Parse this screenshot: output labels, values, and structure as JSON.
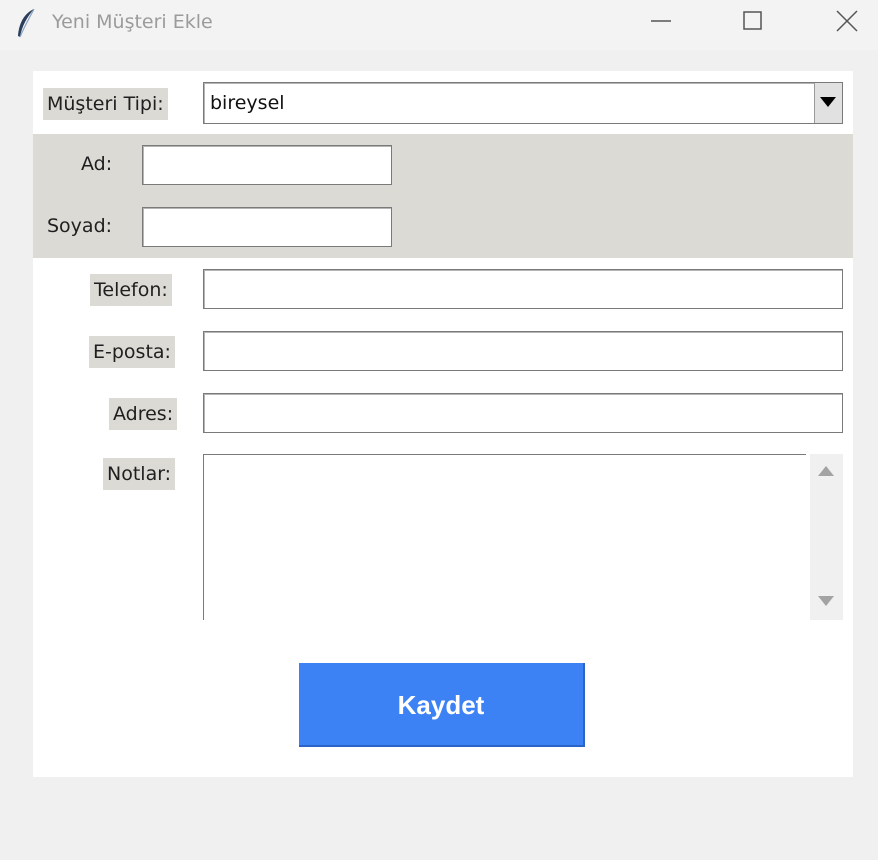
{
  "window": {
    "title": "Yeni Müşteri Ekle",
    "app_icon": "feather-icon",
    "controls": [
      "minimize-icon",
      "maximize-icon",
      "close-icon"
    ]
  },
  "form": {
    "customer_type": {
      "label": "Müşteri Tipi:",
      "value": "bireysel"
    },
    "first_name": {
      "label": "Ad:",
      "value": ""
    },
    "last_name": {
      "label": "Soyad:",
      "value": ""
    },
    "phone": {
      "label": "Telefon:",
      "value": ""
    },
    "email": {
      "label": "E-posta:",
      "value": ""
    },
    "address": {
      "label": "Adres:",
      "value": ""
    },
    "notes": {
      "label": "Notlar:",
      "value": ""
    }
  },
  "actions": {
    "save_label": "Kaydet"
  },
  "colors": {
    "label_bg": "#dcdad5",
    "save_button": "#3d82f5",
    "panel_bg": "#ffffff",
    "window_bg": "#f0f0f0"
  }
}
